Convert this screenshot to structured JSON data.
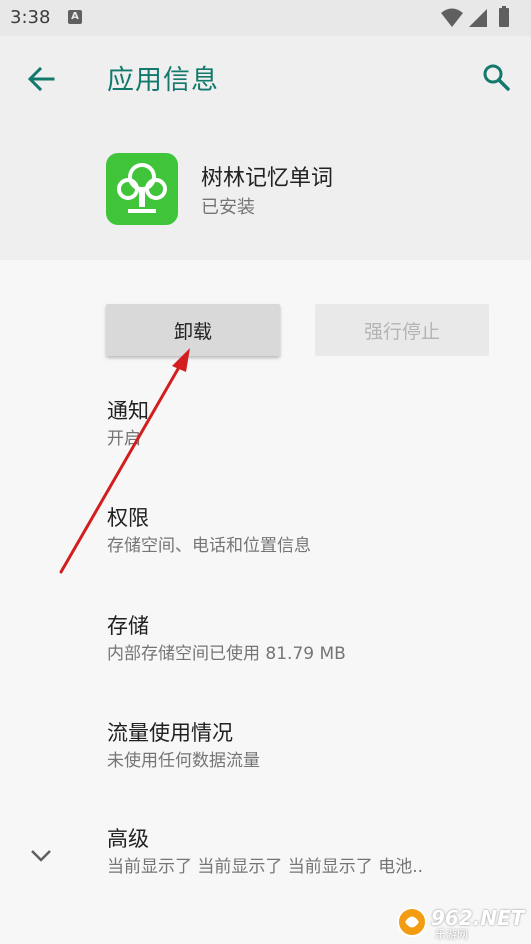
{
  "status_bar": {
    "time": "3:38",
    "notification_letter": "A"
  },
  "header": {
    "title": "应用信息",
    "accent_color": "#14796d"
  },
  "app": {
    "name": "树林记忆单词",
    "install_status": "已安装",
    "icon_color": "#3fc43a"
  },
  "buttons": {
    "uninstall": "卸载",
    "force_stop": "强行停止"
  },
  "settings": [
    {
      "title": "通知",
      "subtitle": "开启"
    },
    {
      "title": "权限",
      "subtitle": "存储空间、电话和位置信息"
    },
    {
      "title": "存储",
      "subtitle": "内部存储空间已使用 81.79 MB"
    },
    {
      "title": "流量使用情况",
      "subtitle": "未使用任何数据流量"
    },
    {
      "title": "高级",
      "subtitle": "当前显示了 当前显示了 当前显示了 电池.."
    }
  ],
  "watermark": {
    "text": "962.NET",
    "sub": "乐游网"
  }
}
